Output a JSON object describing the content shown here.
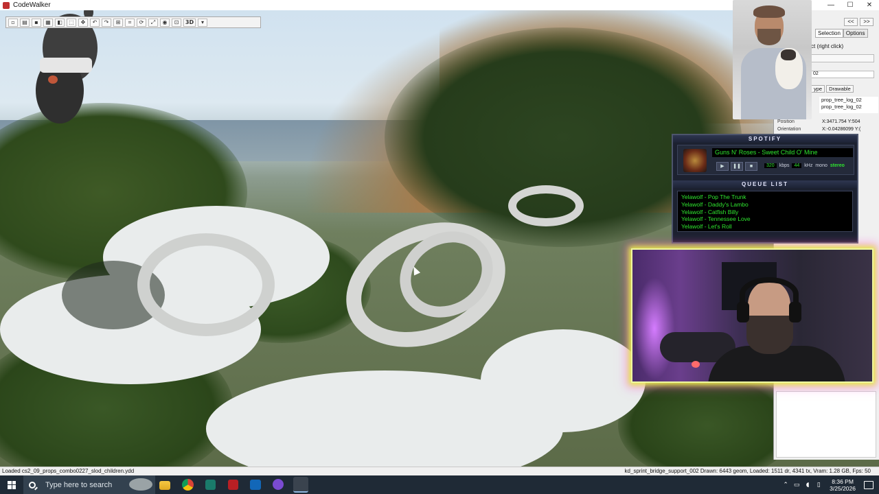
{
  "window": {
    "title": "CodeWalker",
    "controls": [
      "—",
      "☐",
      "✕"
    ]
  },
  "toolbar": {
    "buttons": [
      "new",
      "open",
      "save",
      "grid",
      "view",
      "select",
      "move",
      "undo",
      "redo",
      "snap",
      "wireframe",
      "rotate",
      "scale",
      "camera",
      "zoom",
      "lock",
      "3D"
    ],
    "mode_label": "3D"
  },
  "selection_panel": {
    "tabs": [
      "Selection",
      "Options"
    ],
    "nav": [
      "<<",
      ">>"
    ],
    "hint": "ct (right click)",
    "field_value": "02",
    "subtabs": [
      "ype",
      "Drawable"
    ],
    "list_items": [
      "prop_tree_log_02",
      "prop_tree_log_02"
    ],
    "position_label": "Position",
    "position_value": "X:3471.754 Y:504",
    "orientation_label": "Orientation",
    "orientation_value": "X:-0.04286099 Y:("
  },
  "spotify": {
    "header": "SPOTIFY",
    "now_playing": "Guns N' Roses - Sweet Child O' Mine",
    "controls": [
      "▶",
      "❚❚",
      "■"
    ],
    "kbps": "320",
    "kbps_label": "kbps",
    "khz": "44",
    "khz_label": "kHz",
    "mono": "mono",
    "stereo": "stereo",
    "queue_header": "QUEUE LIST",
    "queue": [
      "Yelawolf - Pop The Trunk",
      "Yelawolf - Daddy's Lambo",
      "Yelawolf - Catfish Billy",
      "Yelawolf - Tennessee Love",
      "Yelawolf - Let's Roll"
    ]
  },
  "statusbar": {
    "left": "Loaded cs2_09_props_combo0227_slod_children.ydd",
    "right": "kd_sprint_bridge_support_002   Drawn: 6443 geom, Loaded: 1511 dr, 4341 tx, Vram: 1.28 GB, Fps: 50"
  },
  "taskbar": {
    "search_placeholder": "Type here to search",
    "apps": [
      "file-explorer",
      "chrome",
      "calculator",
      "acrobat",
      "outlook",
      "discord",
      "codewalker"
    ],
    "time": "8:36 PM",
    "date": "3/25/2026"
  },
  "colors": {
    "spotify_green": "#2fe62f",
    "cam_border_glow": "#e3f53c",
    "taskbar_bg": "#1f2a36"
  }
}
